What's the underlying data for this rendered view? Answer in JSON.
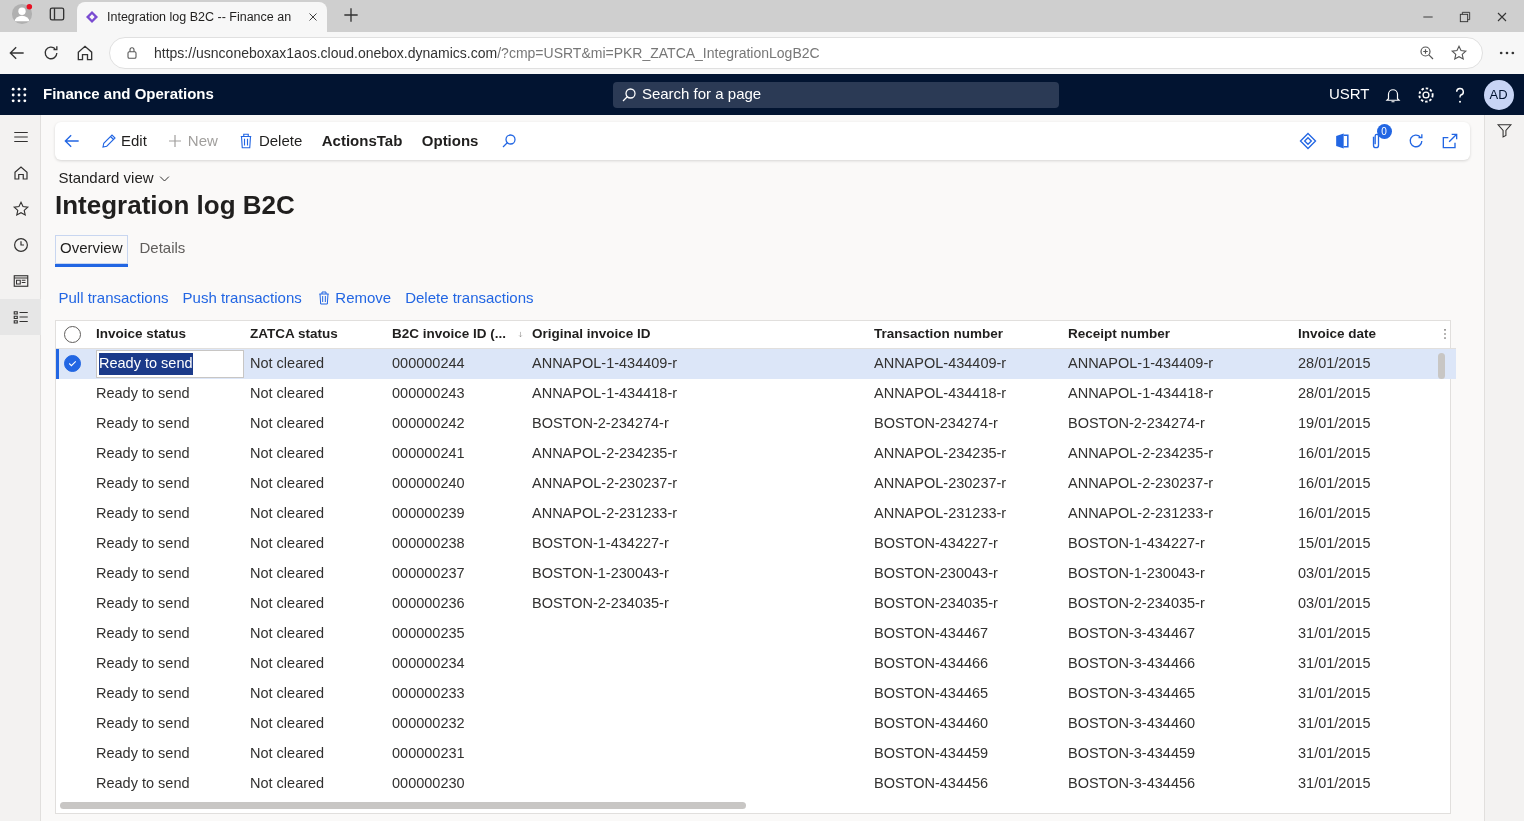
{
  "browser": {
    "tab_title": "Integration log B2C -- Finance an",
    "url_host": "https://usnconeboxax1aos.cloud.onebox.dynamics.com",
    "url_rest": "/?cmp=USRT&mi=PKR_ZATCA_IntegrationLogB2C"
  },
  "app": {
    "title": "Finance and Operations",
    "search_placeholder": "Search for a page",
    "company": "USRT",
    "avatar": "AD"
  },
  "toolbar": [
    {
      "kind": "back"
    },
    {
      "kind": "edit",
      "label": "Edit",
      "disabled": false
    },
    {
      "kind": "new",
      "label": "New",
      "disabled": true
    },
    {
      "kind": "delete",
      "label": "Delete",
      "disabled": false
    },
    {
      "kind": "menu",
      "label": "ActionsTab",
      "disabled": false
    },
    {
      "kind": "menu",
      "label": "Options",
      "disabled": false
    },
    {
      "kind": "search"
    }
  ],
  "attachments_count": "0",
  "view": "Standard view",
  "page_title": "Integration log B2C",
  "tabs": [
    {
      "label": "Overview",
      "selected": true
    },
    {
      "label": "Details",
      "selected": false
    }
  ],
  "actions": [
    {
      "kind": "link",
      "label": "Pull transactions"
    },
    {
      "kind": "link",
      "label": "Push transactions"
    },
    {
      "kind": "delete",
      "label": "Remove"
    },
    {
      "kind": "link",
      "label": "Delete transactions"
    }
  ],
  "table": {
    "all_selected": false,
    "columns": [
      "Invoice status",
      "ZATCA status",
      "B2C invoice ID (...",
      "Original invoice ID",
      "Transaction number",
      "Receipt number",
      "Invoice date"
    ],
    "rows": [
      {
        "selected": true,
        "cells": [
          "Ready to send",
          "Not cleared",
          "000000244",
          "ANNAPOL-1-434409-r",
          "ANNAPOL-434409-r",
          "ANNAPOL-1-434409-r",
          "28/01/2015"
        ]
      },
      {
        "selected": false,
        "cells": [
          "Ready to send",
          "Not cleared",
          "000000243",
          "ANNAPOL-1-434418-r",
          "ANNAPOL-434418-r",
          "ANNAPOL-1-434418-r",
          "28/01/2015"
        ]
      },
      {
        "selected": false,
        "cells": [
          "Ready to send",
          "Not cleared",
          "000000242",
          "BOSTON-2-234274-r",
          "BOSTON-234274-r",
          "BOSTON-2-234274-r",
          "19/01/2015"
        ]
      },
      {
        "selected": false,
        "cells": [
          "Ready to send",
          "Not cleared",
          "000000241",
          "ANNAPOL-2-234235-r",
          "ANNAPOL-234235-r",
          "ANNAPOL-2-234235-r",
          "16/01/2015"
        ]
      },
      {
        "selected": false,
        "cells": [
          "Ready to send",
          "Not cleared",
          "000000240",
          "ANNAPOL-2-230237-r",
          "ANNAPOL-230237-r",
          "ANNAPOL-2-230237-r",
          "16/01/2015"
        ]
      },
      {
        "selected": false,
        "cells": [
          "Ready to send",
          "Not cleared",
          "000000239",
          "ANNAPOL-2-231233-r",
          "ANNAPOL-231233-r",
          "ANNAPOL-2-231233-r",
          "16/01/2015"
        ]
      },
      {
        "selected": false,
        "cells": [
          "Ready to send",
          "Not cleared",
          "000000238",
          "BOSTON-1-434227-r",
          "BOSTON-434227-r",
          "BOSTON-1-434227-r",
          "15/01/2015"
        ]
      },
      {
        "selected": false,
        "cells": [
          "Ready to send",
          "Not cleared",
          "000000237",
          "BOSTON-1-230043-r",
          "BOSTON-230043-r",
          "BOSTON-1-230043-r",
          "03/01/2015"
        ]
      },
      {
        "selected": false,
        "cells": [
          "Ready to send",
          "Not cleared",
          "000000236",
          "BOSTON-2-234035-r",
          "BOSTON-234035-r",
          "BOSTON-2-234035-r",
          "03/01/2015"
        ]
      },
      {
        "selected": false,
        "cells": [
          "Ready to send",
          "Not cleared",
          "000000235",
          "",
          "BOSTON-434467",
          "BOSTON-3-434467",
          "31/01/2015"
        ]
      },
      {
        "selected": false,
        "cells": [
          "Ready to send",
          "Not cleared",
          "000000234",
          "",
          "BOSTON-434466",
          "BOSTON-3-434466",
          "31/01/2015"
        ]
      },
      {
        "selected": false,
        "cells": [
          "Ready to send",
          "Not cleared",
          "000000233",
          "",
          "BOSTON-434465",
          "BOSTON-3-434465",
          "31/01/2015"
        ]
      },
      {
        "selected": false,
        "cells": [
          "Ready to send",
          "Not cleared",
          "000000232",
          "",
          "BOSTON-434460",
          "BOSTON-3-434460",
          "31/01/2015"
        ]
      },
      {
        "selected": false,
        "cells": [
          "Ready to send",
          "Not cleared",
          "000000231",
          "",
          "BOSTON-434459",
          "BOSTON-3-434459",
          "31/01/2015"
        ]
      },
      {
        "selected": false,
        "cells": [
          "Ready to send",
          "Not cleared",
          "000000230",
          "",
          "BOSTON-434456",
          "BOSTON-3-434456",
          "31/01/2015"
        ]
      }
    ]
  }
}
